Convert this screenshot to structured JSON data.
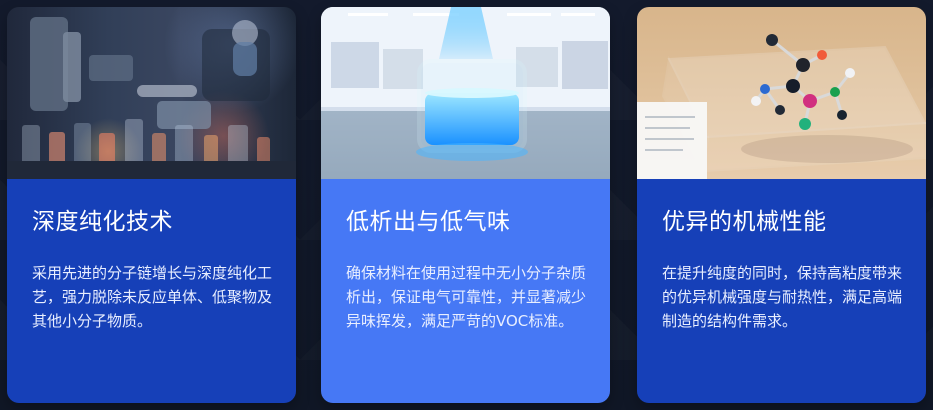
{
  "cards": [
    {
      "title": "深度纯化技术",
      "description": "采用先进的分子链增长与深度纯化工艺，强力脱除未反应单体、低聚物及其他小分子物质。"
    },
    {
      "title": "低析出与低气味",
      "description": "确保材料在使用过程中无小分子杂质析出，保证电气可靠性，并显著减少异味挥发，满足严苛的VOC标准。"
    },
    {
      "title": "优异的机械性能",
      "description": "在提升纯度的同时，保持高粘度带来的优异机械强度与耐热性，满足高端制造的结构件需求。"
    }
  ],
  "colors": {
    "background": "#131a2c",
    "card_primary": "#1640b8",
    "card_highlight": "#4678f5",
    "text": "#ffffff"
  }
}
